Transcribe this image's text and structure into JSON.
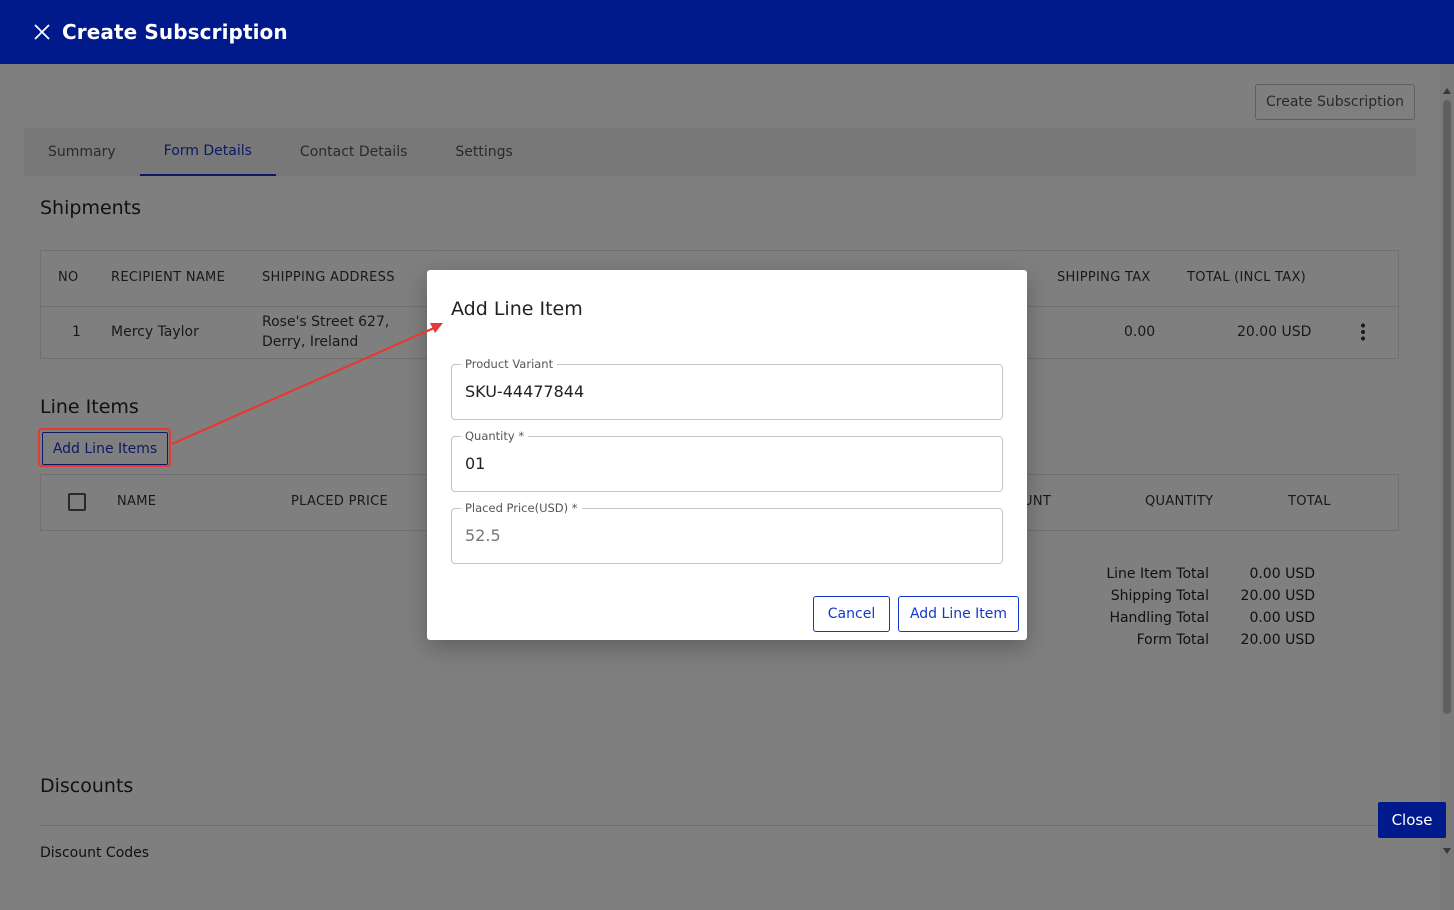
{
  "header": {
    "title": "Create Subscription"
  },
  "actions": {
    "create_label": "Create Subscription",
    "close_label": "Close"
  },
  "tabs": [
    {
      "label": "Summary"
    },
    {
      "label": "Form Details"
    },
    {
      "label": "Contact Details"
    },
    {
      "label": "Settings"
    }
  ],
  "shipments": {
    "title": "Shipments",
    "headers": {
      "no": "NO",
      "recipient": "RECIPIENT NAME",
      "address": "SHIPPING ADDRESS",
      "tax": "SHIPPING TAX",
      "total": "TOTAL (INCL TAX)"
    },
    "row": {
      "no": "1",
      "recipient": "Mercy Taylor",
      "address_line1": "Rose's Street 627,",
      "address_line2": "Derry, Ireland",
      "tax": "0.00",
      "total": "20.00 USD"
    }
  },
  "line_items": {
    "title": "Line Items",
    "add_label": "Add Line Items",
    "headers": {
      "name": "NAME",
      "placed_price": "PLACED PRICE",
      "discount_partial": "UNT",
      "quantity": "QUANTITY",
      "total": "TOTAL"
    },
    "totals": [
      {
        "label": "Line Item Total",
        "value": "0.00 USD"
      },
      {
        "label": "Shipping Total",
        "value": "20.00 USD"
      },
      {
        "label": "Handling Total",
        "value": "0.00 USD"
      },
      {
        "label": "Form Total",
        "value": "20.00 USD"
      }
    ]
  },
  "discounts": {
    "title": "Discounts",
    "codes_label": "Discount Codes"
  },
  "modal": {
    "title": "Add Line Item",
    "fields": {
      "variant": {
        "label": "Product Variant",
        "value": "SKU-44477844"
      },
      "quantity": {
        "label": "Quantity *",
        "value": "01"
      },
      "price": {
        "label": "Placed Price(USD) *",
        "value": "52.5"
      }
    },
    "cancel_label": "Cancel",
    "add_label": "Add Line Item"
  },
  "colors": {
    "header_bg": "#001a8c",
    "accent": "#1436c8",
    "annotation": "#e53935"
  },
  "icons": {
    "close": "close-x-icon",
    "more": "more-vertical-icon"
  }
}
